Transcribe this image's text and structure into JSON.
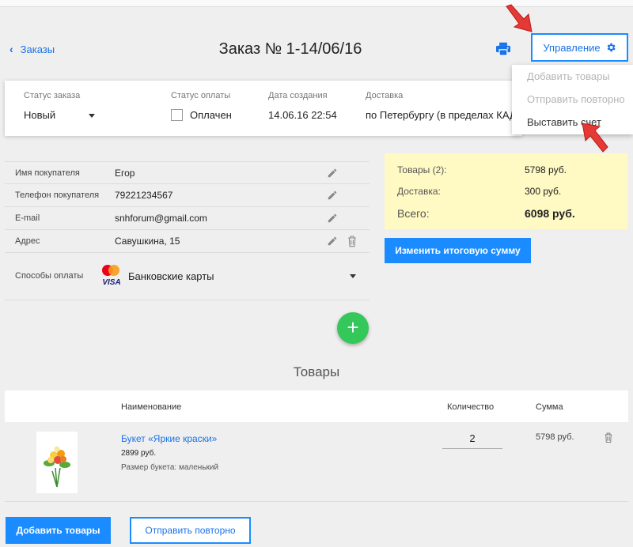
{
  "header": {
    "back_label": "Заказы",
    "title": "Заказ № 1-14/06/16",
    "manage_label": "Управление",
    "print_icon": "print-icon",
    "gear_icon": "gear-icon"
  },
  "manage_menu": {
    "items": [
      {
        "label": "Добавить товары",
        "enabled": false
      },
      {
        "label": "Отправить повторно",
        "enabled": false
      },
      {
        "label": "Выставить счет",
        "enabled": true
      }
    ]
  },
  "order_card": {
    "status_label": "Статус заказа",
    "status_value": "Новый",
    "payment_label": "Статус оплаты",
    "payment_value": "Оплачен",
    "payment_checked": false,
    "created_label": "Дата создания",
    "created_value": "14.06.16 22:54",
    "delivery_label": "Доставка",
    "delivery_value": "по Петербургу (в пределах КАД)"
  },
  "customer": {
    "rows": [
      {
        "label": "Имя покупателя",
        "value": "Егор"
      },
      {
        "label": "Телефон покупателя",
        "value": "79221234567"
      },
      {
        "label": "E-mail",
        "value": "snhforum@gmail.com"
      },
      {
        "label": "Адрес",
        "value": "Савушкина, 15"
      }
    ],
    "payment_methods_label": "Способы оплаты",
    "payment_methods_value": "Банковские карты",
    "card_logo_text": "VISA"
  },
  "summary": {
    "goods_label": "Товары (2):",
    "goods_value": "5798 руб.",
    "delivery_label": "Доставка:",
    "delivery_value": "300 руб.",
    "total_label": "Всего:",
    "total_value": "6098 руб.",
    "change_button": "Изменить итоговую сумму",
    "background_color": "#fff9c4"
  },
  "goods": {
    "section_title": "Товары",
    "columns": [
      "Наименование",
      "Количество",
      "Сумма"
    ],
    "items": [
      {
        "name": "Букет «Яркие краски»",
        "price": "2899 руб.",
        "size": "Размер букета: маленький",
        "quantity": "2",
        "sum": "5798 руб."
      }
    ]
  },
  "footer": {
    "add_button": "Добавить товары",
    "resend_button": "Отправить повторно"
  },
  "colors": {
    "accent": "#1a8cff",
    "fab": "#34c759",
    "arrow": "#e53935"
  }
}
